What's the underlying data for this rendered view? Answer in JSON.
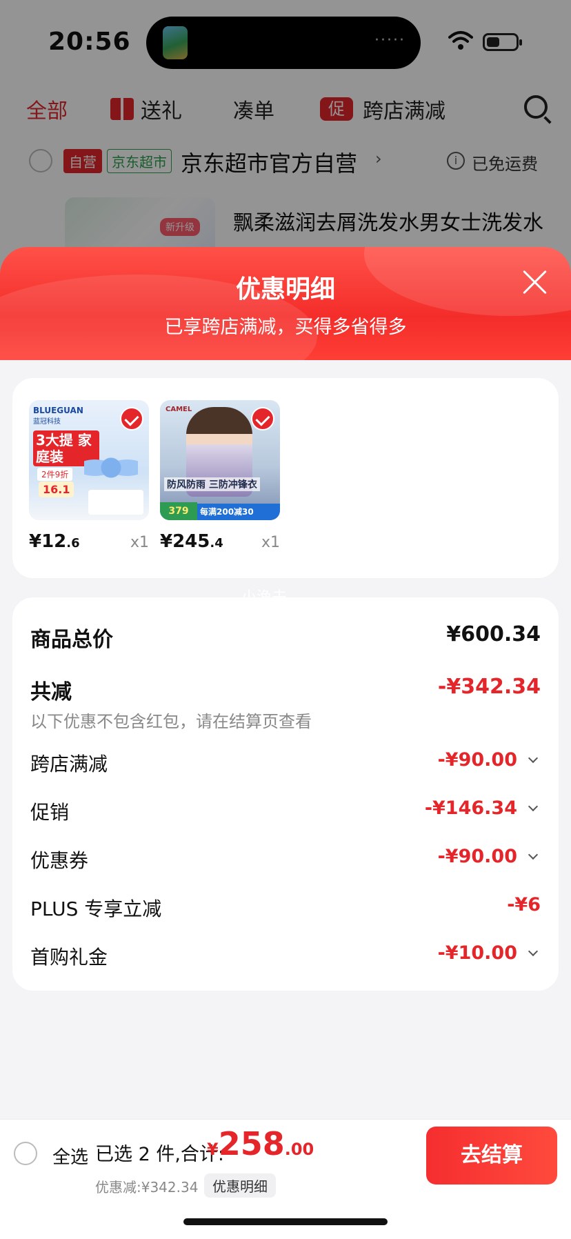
{
  "status_bar": {
    "time": "20:56"
  },
  "tabs": {
    "all": "全部",
    "gift": "送礼",
    "bundle": "凑单",
    "cross_store_badge": "促",
    "cross_store": "跨店满减"
  },
  "shop": {
    "self_badge": "自营",
    "supermarket_badge": "京东超市",
    "name": "京东超市官方自营",
    "chevron": "›",
    "shipping": "已免运费"
  },
  "background_product": {
    "badge": "新升级",
    "title": "飘柔滋润去屑洗发水男女士洗发水"
  },
  "sheet": {
    "title": "优惠明细",
    "subtitle": "已享跨店满减，买得多省得多"
  },
  "products": [
    {
      "brand": "BLUEGUAN",
      "brand_cn": "蓝冠科技",
      "promo": "3大提 家庭装",
      "promo_sub": "2件9折",
      "price_tag": "16.1",
      "price_int": "¥12",
      "price_dec": ".6",
      "qty": "x1"
    },
    {
      "brand": "CAMEL",
      "caption": "防风防雨 三防冲锋衣",
      "tag_price": "379",
      "tag_promo": "每满200减30",
      "price_int": "¥245",
      "price_dec": ".4",
      "qty": "x1"
    }
  ],
  "watermark": "小渔夫",
  "summary": {
    "total_label": "商品总价",
    "total_value": "¥600.34",
    "reduce_label": "共减",
    "reduce_value": "-¥342.34",
    "note": "以下优惠不包含红包，请在结算页查看",
    "items": [
      {
        "label": "跨店满减",
        "value": "-¥90.00"
      },
      {
        "label": "促销",
        "value": "-¥146.34"
      },
      {
        "label": "优惠券",
        "value": "-¥90.00"
      },
      {
        "label": "PLUS 专享立减",
        "value": "-¥6"
      },
      {
        "label": "首购礼金",
        "value": "-¥10.00"
      }
    ]
  },
  "bottom_bar": {
    "select_all": "全选",
    "selected_text": "已选 2 件,合计:",
    "price_yen": "¥",
    "price_int": "258",
    "price_dec": ".00",
    "saved": "优惠减:¥342.34",
    "detail": "优惠明细",
    "checkout": "去结算"
  },
  "colors": {
    "accent": "#e4262b",
    "header_red": "#f42d2a"
  }
}
